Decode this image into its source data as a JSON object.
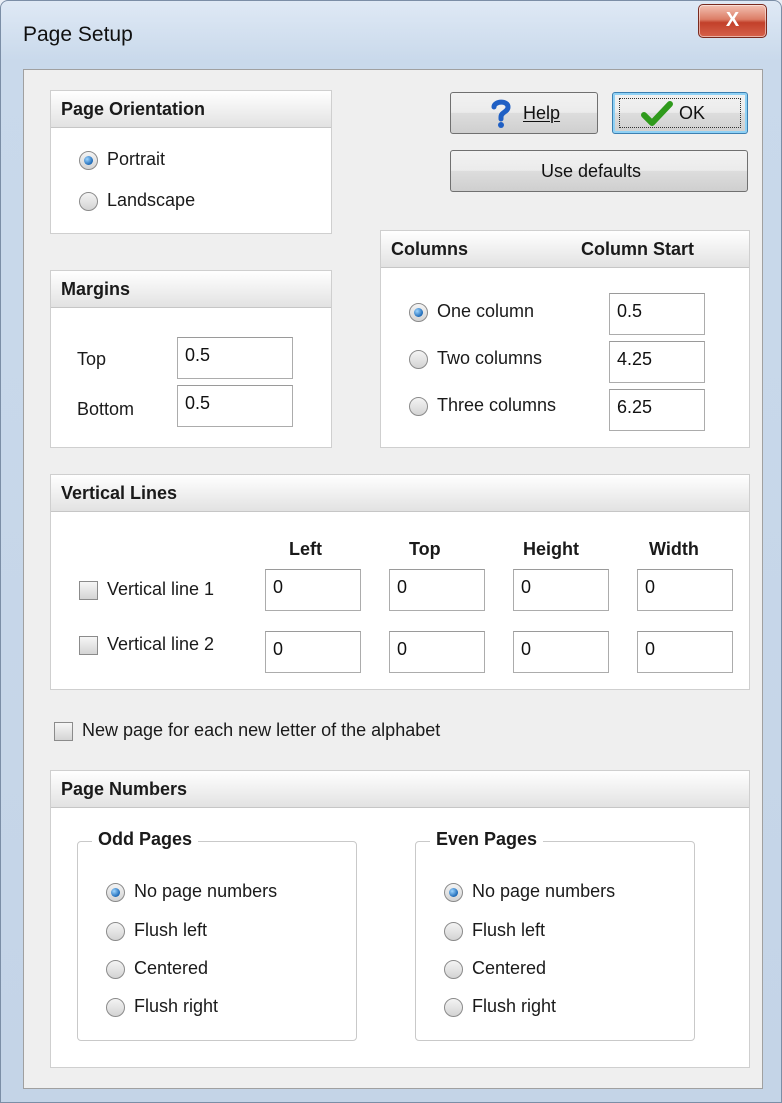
{
  "window": {
    "title": "Page Setup",
    "close_label": "X"
  },
  "buttons": {
    "help": "Help",
    "ok": "OK",
    "use_defaults": "Use defaults"
  },
  "orientation": {
    "title": "Page Orientation",
    "options": [
      {
        "label": "Portrait",
        "selected": true
      },
      {
        "label": "Landscape",
        "selected": false
      }
    ]
  },
  "margins": {
    "title": "Margins",
    "top_label": "Top",
    "top_value": "0.5",
    "bottom_label": "Bottom",
    "bottom_value": "0.5"
  },
  "columns": {
    "title": "Columns",
    "start_title": "Column Start",
    "options": [
      {
        "label": "One column",
        "selected": true,
        "start": "0.5"
      },
      {
        "label": "Two columns",
        "selected": false,
        "start": "4.25"
      },
      {
        "label": "Three columns",
        "selected": false,
        "start": "6.25"
      }
    ]
  },
  "vertical_lines": {
    "title": "Vertical Lines",
    "headers": [
      "Left",
      "Top",
      "Height",
      "Width"
    ],
    "rows": [
      {
        "label": "Vertical line 1",
        "checked": false,
        "values": [
          "0",
          "0",
          "0",
          "0"
        ]
      },
      {
        "label": "Vertical line 2",
        "checked": false,
        "values": [
          "0",
          "0",
          "0",
          "0"
        ]
      }
    ]
  },
  "alphabet_option": {
    "label": "New page for each new letter of the alphabet",
    "checked": false
  },
  "page_numbers": {
    "title": "Page Numbers",
    "odd": {
      "title": "Odd Pages",
      "options": [
        {
          "label": "No page numbers",
          "selected": true
        },
        {
          "label": "Flush left",
          "selected": false
        },
        {
          "label": "Centered",
          "selected": false
        },
        {
          "label": "Flush right",
          "selected": false
        }
      ]
    },
    "even": {
      "title": "Even Pages",
      "options": [
        {
          "label": "No page numbers",
          "selected": true
        },
        {
          "label": "Flush left",
          "selected": false
        },
        {
          "label": "Centered",
          "selected": false
        },
        {
          "label": "Flush right",
          "selected": false
        }
      ]
    }
  },
  "colors": {
    "accent": "#1d6ab8",
    "ok_check": "#2f9a1c",
    "help_icon": "#1f5fc4",
    "close": "#c2402a"
  },
  "icons": {
    "help": "question-mark-icon",
    "ok": "checkmark-icon",
    "close": "close-icon"
  }
}
